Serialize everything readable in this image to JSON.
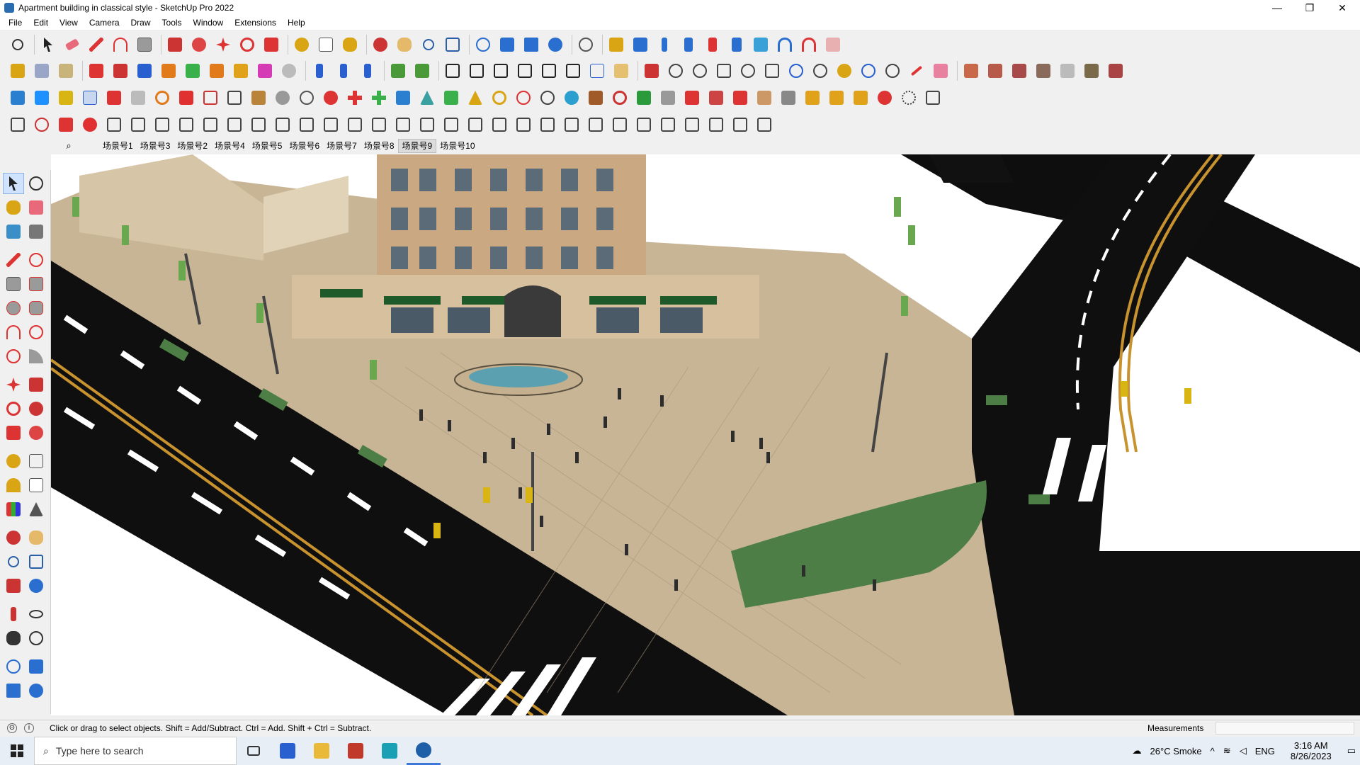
{
  "window": {
    "title": "Apartment building in classical style - SketchUp Pro 2022",
    "controls": [
      "—",
      "❐",
      "✕"
    ]
  },
  "menu": [
    "File",
    "Edit",
    "View",
    "Camera",
    "Draw",
    "Tools",
    "Window",
    "Extensions",
    "Help"
  ],
  "scenes": {
    "tabs": [
      "场景号1",
      "场景号3",
      "场景号2",
      "场景号4",
      "场景号5",
      "场景号6",
      "场景号7",
      "场景号8",
      "场景号9",
      "场景号10"
    ],
    "active_index": 8
  },
  "status": {
    "hint": "Click or drag to select objects. Shift = Add/Subtract. Ctrl = Add. Shift + Ctrl = Subtract.",
    "measurements_label": "Measurements",
    "measurements_value": ""
  },
  "taskbar": {
    "search_placeholder": "Type here to search",
    "weather": "26°C  Smoke",
    "language": "ENG",
    "time": "3:16 AM",
    "date": "8/26/2023"
  },
  "colors": {
    "road": "#111111",
    "lane_mark": "#ffffff",
    "center_line": "#c8932e",
    "plaza": "#c8b596",
    "building": "#c9a882",
    "lawn": "#4c7e45",
    "awning": "#1f5a2a",
    "water": "#5aa0b0"
  }
}
